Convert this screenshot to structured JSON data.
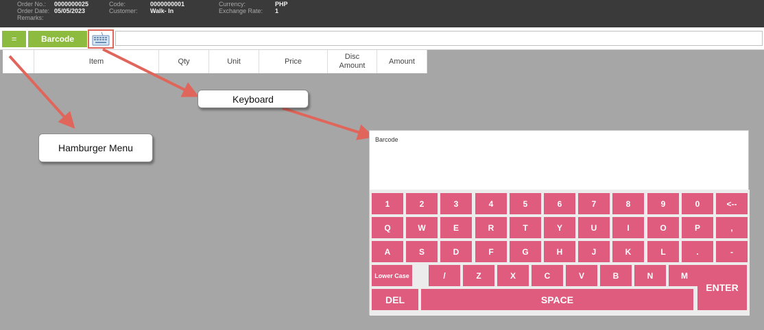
{
  "header": {
    "order_no_label": "Order No.:",
    "order_no": "0000000025",
    "order_date_label": "Order Date:",
    "order_date": "05/05/2023",
    "remarks_label": "Remarks:",
    "code_label": "Code:",
    "code": "0000000001",
    "customer_label": "Customer:",
    "customer": "Walk- In",
    "currency_label": "Currency:",
    "currency": "PHP",
    "exchange_rate_label": "Exchange Rate:",
    "exchange_rate": "1"
  },
  "toolbar": {
    "menu_label": "=",
    "barcode_label": "Barcode",
    "keyboard_icon": "keyboard-icon",
    "barcode_value": ""
  },
  "table": {
    "columns": [
      "",
      "Item",
      "Qty",
      "Unit",
      "Price",
      "Disc Amount",
      "Amount"
    ]
  },
  "callouts": {
    "keyboard": "Keyboard",
    "hamburger": "Hamburger Menu"
  },
  "keyboard": {
    "display_label": "Barcode",
    "rows": [
      [
        "1",
        "2",
        "3",
        "4",
        "5",
        "6",
        "7",
        "8",
        "9",
        "0",
        "<--"
      ],
      [
        "Q",
        "W",
        "E",
        "R",
        "T",
        "Y",
        "U",
        "I",
        "O",
        "P",
        ","
      ],
      [
        "A",
        "S",
        "D",
        "F",
        "G",
        "H",
        "J",
        "K",
        "L",
        ".",
        "-"
      ]
    ],
    "row4": [
      "Lower Case",
      "/",
      "Z",
      "X",
      "C",
      "V",
      "B",
      "N",
      "M"
    ],
    "enter": "ENTER",
    "del": "DEL",
    "space": "SPACE"
  },
  "colors": {
    "header_bg": "#3a3a3a",
    "accent_green": "#8dbb3f",
    "key_pink": "#e05c7f",
    "annotation_red": "#e0655a",
    "workspace_gray": "#a6a6a6"
  }
}
